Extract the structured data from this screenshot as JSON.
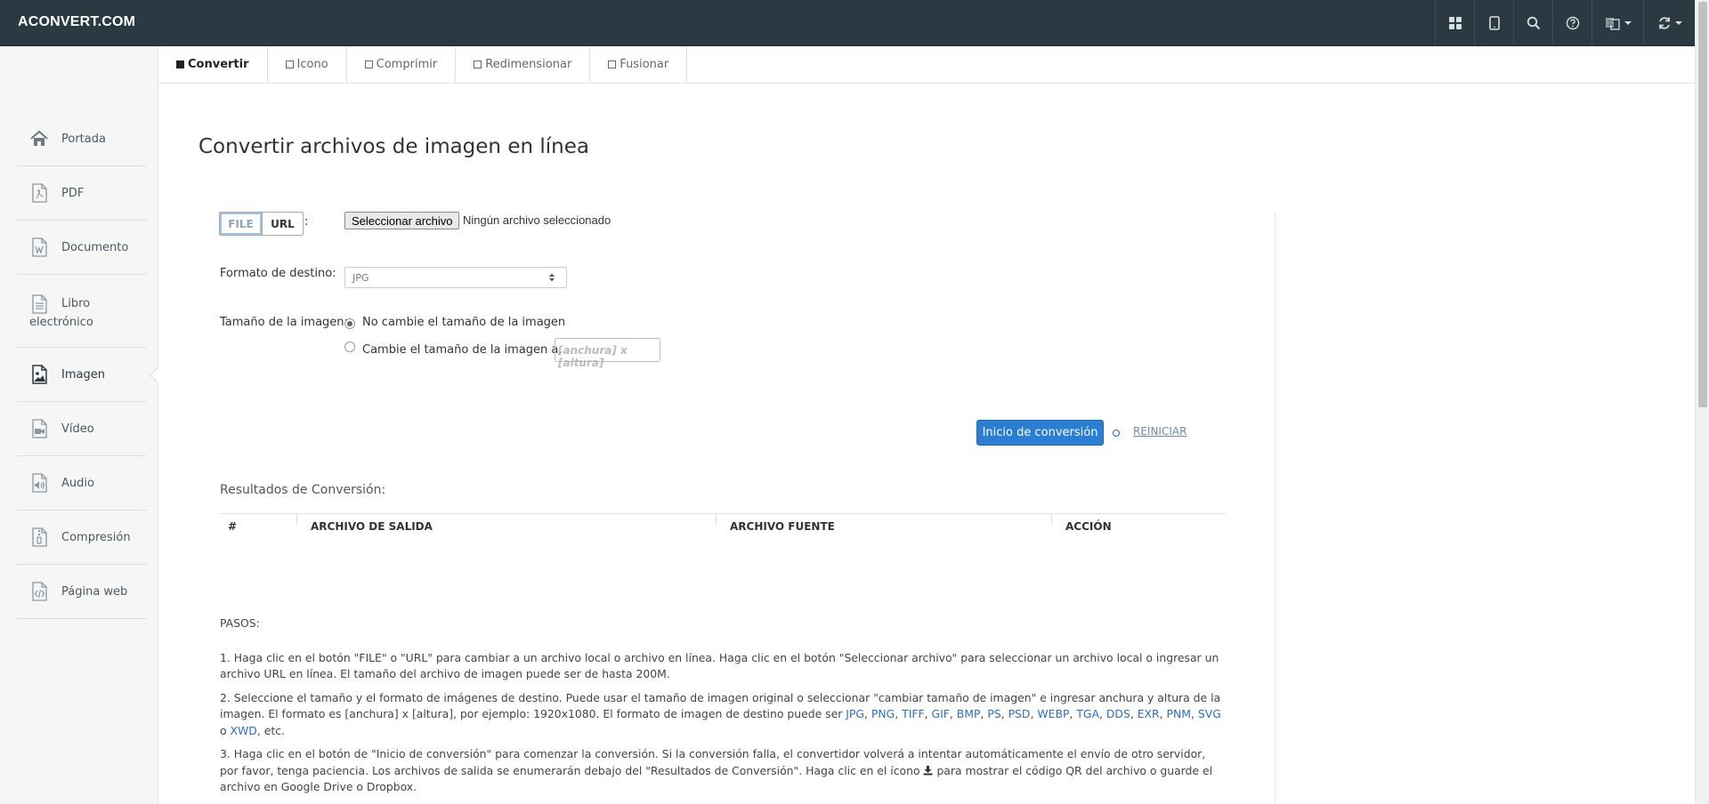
{
  "navbar": {
    "brand": "ACONVERT.COM",
    "icons": [
      "apps-grid-icon",
      "tablet-icon",
      "search-icon",
      "help-icon",
      "language-icon",
      "refresh-icon"
    ]
  },
  "sidebar": {
    "items": [
      {
        "label": "Portada",
        "icon": "home-icon"
      },
      {
        "label": "PDF",
        "icon": "pdf-file-icon"
      },
      {
        "label": "Documento",
        "icon": "word-document-icon"
      },
      {
        "label": "Libro electrónico",
        "icon": "ebook-icon"
      },
      {
        "label": "Imagen",
        "icon": "image-icon",
        "active": true
      },
      {
        "label": "Vídeo",
        "icon": "video-icon"
      },
      {
        "label": "Audio",
        "icon": "audio-icon"
      },
      {
        "label": "Compresión",
        "icon": "archive-icon"
      },
      {
        "label": "Página web",
        "icon": "code-file-icon"
      }
    ]
  },
  "tabs": [
    {
      "label": "Convertir",
      "active": true
    },
    {
      "label": "Icono"
    },
    {
      "label": "Comprimir"
    },
    {
      "label": "Redimensionar"
    },
    {
      "label": "Fusionar"
    }
  ],
  "main": {
    "title": "Convertir archivos de imagen en línea",
    "source_toggle": {
      "file": "FILE",
      "url": "URL",
      "colon": ":"
    },
    "file_button": "Seleccionar archivo",
    "file_status": "Ningún archivo seleccionado",
    "format_label": "Formato de destino:",
    "format_value": "JPG",
    "size_label": "Tamaño de la imagen:",
    "size_option_keep": "No cambie el tamaño de la imagen",
    "size_option_resize": "Cambie el tamaño de la imagen a:",
    "size_placeholder": "[anchura] x [altura]",
    "start_button": "Inicio de conversión",
    "or_text": "o",
    "reset_link": "REINICIAR"
  },
  "results": {
    "title": "Resultados de Conversión:",
    "columns": [
      "#",
      "ARCHIVO DE SALIDA",
      "ARCHIVO FUENTE",
      "ACCIÓN"
    ]
  },
  "steps": {
    "heading": "PASOS:",
    "step1": "1. Haga clic en el botón \"FILE\" o \"URL\" para cambiar a un archivo local o archivo en línea. Haga clic en el botón \"Seleccionar archivo\" para seleccionar un archivo local o ingresar un archivo URL en línea. El tamaño del archivo de imagen puede ser de hasta 200M.",
    "step2_pre": "2. Seleccione el tamaño y el formato de imágenes de destino. Puede usar el tamaño de imagen original o seleccionar \"cambiar tamaño de imagen\" e ingresar anchura y altura de la imagen. El formato es [anchura] x [altura], por ejemplo: 1920x1080. El formato de imagen de destino puede ser",
    "step2_formats": [
      "JPG",
      "PNG",
      "TIFF",
      "GIF",
      "BMP",
      "PS",
      "PSD",
      "WEBP",
      "TGA",
      "DDS",
      "EXR",
      "PNM",
      "SVG",
      "XWD"
    ],
    "step2_or": "o",
    "step2_post": ", etc.",
    "step3_pre": "3. Haga clic en el botón de \"Inicio de conversión\" para comenzar la conversión. Si la conversión falla, el convertidor volverá a intentar automáticamente el envío de otro servidor, por favor, tenga paciencia. Los archivos de salida se enumerarán debajo del \"Resultados de Conversión\". Haga clic en el ícono",
    "step3_post": "para mostrar el código QR del archivo o guarde el archivo en Google Drive o Dropbox."
  },
  "colors": {
    "navbar": "#2b3a42",
    "accent": "#2a7fd4",
    "link": "#2a6ec7"
  }
}
